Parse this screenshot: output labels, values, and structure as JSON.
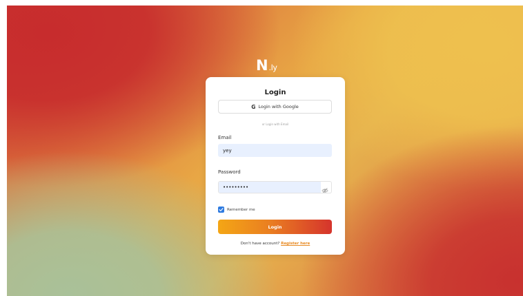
{
  "brand": {
    "logo_main": "N",
    "logo_suffix": ".ly"
  },
  "card": {
    "title": "Login",
    "google_button_label": "Login with Google",
    "divider_text": "or Login with Email",
    "email": {
      "label": "Email",
      "value": "yey",
      "placeholder": ""
    },
    "password": {
      "label": "Password",
      "value": "asdfghjkl",
      "placeholder": ""
    },
    "remember": {
      "label": "Remember me",
      "checked": true
    },
    "login_button_label": "Login",
    "register_prompt": "Don't have account?",
    "register_link": "Register here"
  },
  "icons": {
    "google": "google-icon",
    "password_toggle": "eye-slash-icon",
    "checkbox": "checkmark-icon"
  },
  "colors": {
    "accent_blue": "#2f7be0",
    "autofill_bg": "#e8f0fe",
    "button_gradient_start": "#f4a615",
    "button_gradient_end": "#d5342c",
    "link": "#e88a22"
  }
}
